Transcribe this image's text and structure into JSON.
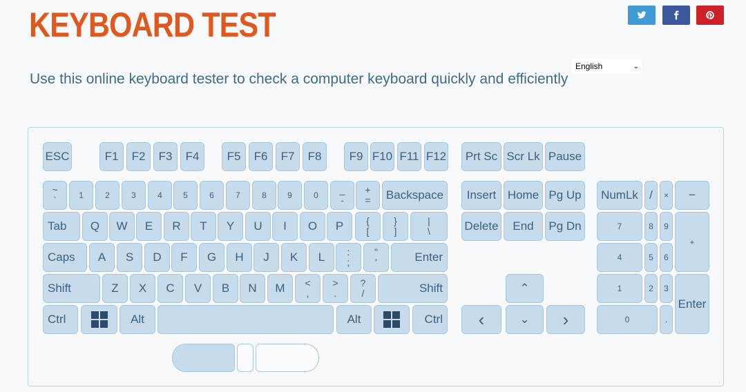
{
  "header": {
    "title": "KEYBOARD TEST",
    "subtitle": "Use this online keyboard tester to check a computer keyboard quickly and efficiently"
  },
  "social": {
    "twitter_icon": "twitter-bird",
    "facebook_icon": "facebook-f",
    "pinterest_icon": "pinterest-p"
  },
  "language": {
    "selected": "English"
  },
  "keys": {
    "esc": "ESC",
    "f1": "F1",
    "f2": "F2",
    "f3": "F3",
    "f4": "F4",
    "f5": "F5",
    "f6": "F6",
    "f7": "F7",
    "f8": "F8",
    "f9": "F9",
    "f10": "F10",
    "f11": "F11",
    "f12": "F12",
    "prtsc": "Prt Sc",
    "scrlk": "Scr Lk",
    "pause": "Pause",
    "tilde_top": "~",
    "tilde_bottom": "`",
    "d1": "1",
    "d2": "2",
    "d3": "3",
    "d4": "4",
    "d5": "5",
    "d6": "6",
    "d7": "7",
    "d8": "8",
    "d9": "9",
    "d0": "0",
    "minus_top": "_",
    "minus_bottom": "-",
    "plus_top": "+",
    "plus_bottom": "=",
    "backspace": "Backspace",
    "insert": "Insert",
    "home": "Home",
    "pgup": "Pg Up",
    "numlk": "NumLk",
    "np_div": "/",
    "np_mul": "×",
    "np_sub": "−",
    "tab": "Tab",
    "q": "Q",
    "w": "W",
    "e": "E",
    "r": "R",
    "t": "T",
    "y": "Y",
    "u": "U",
    "i": "I",
    "o": "O",
    "p": "P",
    "lbr_top": "{",
    "lbr_bottom": "[",
    "rbr_top": "}",
    "rbr_bottom": "]",
    "bs_top": "|",
    "bs_bottom": "\\",
    "delete": "Delete",
    "end": "End",
    "pgdn": "Pg Dn",
    "np7": "7",
    "np8": "8",
    "np9": "9",
    "np_add": "+",
    "caps": "Caps",
    "a": "A",
    "s": "S",
    "d": "D",
    "f": "F",
    "g": "G",
    "h": "H",
    "j": "J",
    "k": "K",
    "l": "L",
    "semi_top": ":",
    "semi_bottom": ";",
    "quote_top": "\"",
    "quote_bottom": "'",
    "enter": "Enter",
    "np4": "4",
    "np5": "5",
    "np6": "6",
    "lshift": "Shift",
    "z": "Z",
    "x": "X",
    "c": "C",
    "v": "V",
    "b": "B",
    "n": "N",
    "m": "M",
    "comma_top": "<",
    "comma_bottom": ",",
    "period_top": ">",
    "period_bottom": ".",
    "slash_top": "?",
    "slash_bottom": "/",
    "rshift": "Shift",
    "up": "⌃",
    "np1": "1",
    "np2": "2",
    "np3": "3",
    "np_enter": "Enter",
    "lctrl": "Ctrl",
    "lalt": "Alt",
    "ralt": "Alt",
    "rctrl": "Ctrl",
    "left": "‹",
    "down": "⌄",
    "right": "›",
    "np0": "0",
    "np_dot": "."
  }
}
